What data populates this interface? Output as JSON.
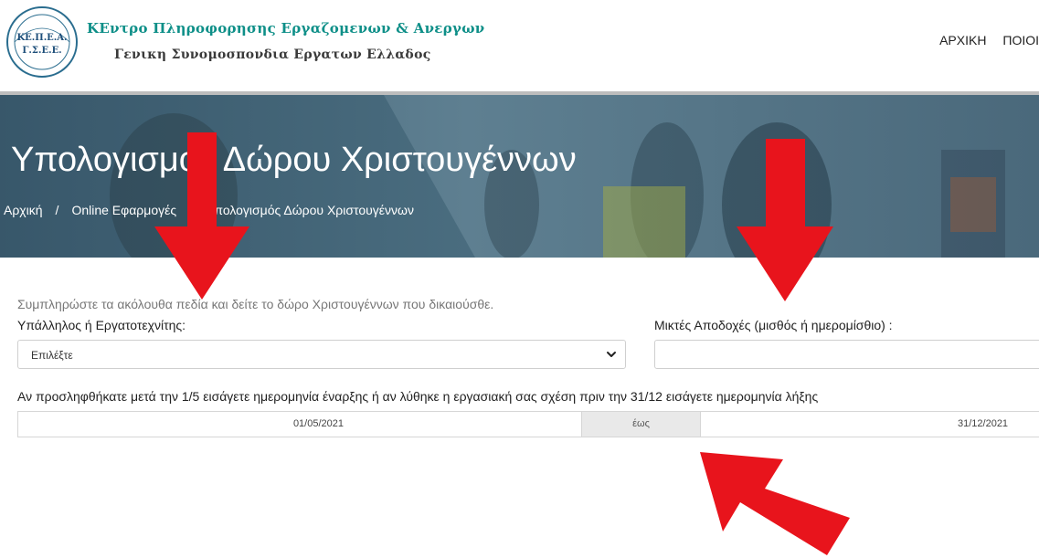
{
  "header": {
    "logo_text": "ΚΕ.Π.Ε.Α. Γ.Σ.Ε.Ε.",
    "org_line1": "ΚΕντρο Πληροφορησης Εργαζομενων & Ανεργων",
    "org_line2": "Γενικη Συνομοσπονδια Εργατων Ελλαδος",
    "nav": [
      "ΑΡΧΙΚΗ",
      "ΠΟΙΟΙ"
    ]
  },
  "hero": {
    "title": "Υπολογισμός Δώρου Χριστουγέννων",
    "breadcrumb": [
      "Αρχική",
      "Online Εφαρμογές",
      "Υπολογισμός Δώρου Χριστουγέννων"
    ],
    "breadcrumb_sep": "/"
  },
  "form": {
    "intro": "Συμπληρώστε τα ακόλουθα πεδία και δείτε το δώρο Χριστουγέννων που δικαιούσθε.",
    "employee_type_label": "Υπάλληλος ή Εργατοτεχνίτης:",
    "employee_type_value": "Επιλέξτε",
    "gross_pay_label": "Μικτές Αποδοχές (μισθός ή ημερομίσθιο) :",
    "gross_pay_value": "",
    "dates_label": "Αν προσληφθήκατε μετά την 1/5 εισάγετε ημερομηνία έναρξης ή αν λύθηκε η εργασιακή σας σχέση πριν την 31/12 εισάγετε ημερομηνία λήξης",
    "start_date": "01/05/2021",
    "date_separator": "έως",
    "end_date": "31/12/2021"
  },
  "colors": {
    "accent_teal": "#0e8f88",
    "arrow_red": "#e8141c"
  }
}
